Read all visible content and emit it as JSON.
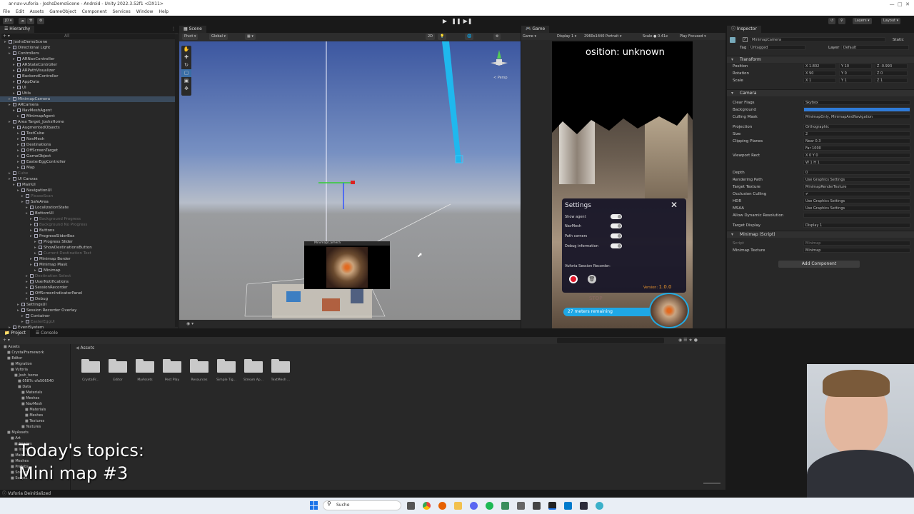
{
  "window": {
    "title": "ar-nav-vuforia - JoshsDemoScene - Android - Unity 2022.3.52f1 <DX11>"
  },
  "menu": [
    "File",
    "Edit",
    "Assets",
    "GameObject",
    "Component",
    "Services",
    "Window",
    "Help"
  ],
  "toolbar": {
    "account": "JD",
    "layers": "Layers",
    "layout": "Layout"
  },
  "hierarchy": {
    "tab": "Hierarchy",
    "search_placeholder": "All",
    "items": [
      {
        "label": "JoshsDemoScene",
        "depth": 1,
        "state": "normal"
      },
      {
        "label": "Directional Light",
        "depth": 2,
        "state": "normal"
      },
      {
        "label": "Controllers",
        "depth": 2,
        "state": "normal"
      },
      {
        "label": "ARNavController",
        "depth": 3,
        "state": "normal"
      },
      {
        "label": "ARStateController",
        "depth": 3,
        "state": "normal"
      },
      {
        "label": "ARPathVisualizer",
        "depth": 3,
        "state": "normal"
      },
      {
        "label": "BackendController",
        "depth": 3,
        "state": "normal"
      },
      {
        "label": "AppData",
        "depth": 3,
        "state": "normal"
      },
      {
        "label": "UI",
        "depth": 3,
        "state": "normal"
      },
      {
        "label": "Utils",
        "depth": 3,
        "state": "normal"
      },
      {
        "label": "MinimapCamera",
        "depth": 2,
        "state": "selected"
      },
      {
        "label": "ARCamera",
        "depth": 2,
        "state": "normal"
      },
      {
        "label": "NavMeshAgent",
        "depth": 3,
        "state": "normal"
      },
      {
        "label": "MinimapAgent",
        "depth": 4,
        "state": "normal"
      },
      {
        "label": "Area Target_JoshsHome",
        "depth": 2,
        "state": "normal"
      },
      {
        "label": "AugmentedObjects",
        "depth": 3,
        "state": "normal"
      },
      {
        "label": "TestCube",
        "depth": 4,
        "state": "normal"
      },
      {
        "label": "NavMesh",
        "depth": 4,
        "state": "normal"
      },
      {
        "label": "Destinations",
        "depth": 4,
        "state": "normal"
      },
      {
        "label": "OffScreenTarget",
        "depth": 4,
        "state": "normal"
      },
      {
        "label": "GameObject",
        "depth": 4,
        "state": "normal"
      },
      {
        "label": "EasterEggController",
        "depth": 4,
        "state": "normal"
      },
      {
        "label": "Map",
        "depth": 4,
        "state": "normal"
      },
      {
        "label": "Cube",
        "depth": 2,
        "state": "dim"
      },
      {
        "label": "UI Canvas",
        "depth": 2,
        "state": "normal"
      },
      {
        "label": "MainUI",
        "depth": 3,
        "state": "normal"
      },
      {
        "label": "NavigationUI",
        "depth": 4,
        "state": "normal"
      },
      {
        "label": "PleaseScan",
        "depth": 5,
        "state": "dim"
      },
      {
        "label": "SafeArea",
        "depth": 5,
        "state": "normal"
      },
      {
        "label": "LocalizationState",
        "depth": 6,
        "state": "normal"
      },
      {
        "label": "BottomUI",
        "depth": 6,
        "state": "normal"
      },
      {
        "label": "Background Progress",
        "depth": 7,
        "state": "dim"
      },
      {
        "label": "Background No Progress",
        "depth": 7,
        "state": "dim"
      },
      {
        "label": "Buttons",
        "depth": 7,
        "state": "normal"
      },
      {
        "label": "ProgressSliderBox",
        "depth": 7,
        "state": "normal"
      },
      {
        "label": "Progress Slider",
        "depth": 8,
        "state": "normal"
      },
      {
        "label": "ShowDestinationsButton",
        "depth": 8,
        "state": "normal"
      },
      {
        "label": "Current Destination Text",
        "depth": 8,
        "state": "dim"
      },
      {
        "label": "Minimap Border",
        "depth": 7,
        "state": "normal"
      },
      {
        "label": "Minimap Mask",
        "depth": 7,
        "state": "normal"
      },
      {
        "label": "Minimap",
        "depth": 8,
        "state": "normal"
      },
      {
        "label": "Destination Select",
        "depth": 6,
        "state": "dim"
      },
      {
        "label": "UserNotifications",
        "depth": 6,
        "state": "normal"
      },
      {
        "label": "SessionRecorder",
        "depth": 6,
        "state": "normal"
      },
      {
        "label": "OffScreenIndicatorPanel",
        "depth": 6,
        "state": "normal"
      },
      {
        "label": "Debug",
        "depth": 6,
        "state": "normal"
      },
      {
        "label": "SettingsUI",
        "depth": 4,
        "state": "normal"
      },
      {
        "label": "Session Recorder Overlay",
        "depth": 4,
        "state": "normal"
      },
      {
        "label": "Container",
        "depth": 5,
        "state": "normal"
      },
      {
        "label": "EasterEggUI",
        "depth": 5,
        "state": "dim"
      },
      {
        "label": "EventSystem",
        "depth": 2,
        "state": "normal"
      }
    ]
  },
  "scene": {
    "tab": "Scene",
    "pivot": "Pivot",
    "global": "Global",
    "mode_2d": "2D",
    "persp": "< Persp",
    "minimap_camera_label": "MinimapCamera"
  },
  "game": {
    "tab": "Game",
    "mode": "Game",
    "display": "Display 1",
    "resolution": "2960x1440 Portrait",
    "scale_label": "Scale",
    "scale_value": "0.41x",
    "play_focused": "Play Focused",
    "position_text": "osition: unknown",
    "settings": {
      "title": "Settings",
      "options": [
        "Show agent",
        "NavMesh",
        "Path corners",
        "Debug information"
      ],
      "recorder_label": "Vuforia Session Recorder:",
      "version_label": "Version:",
      "version_value": "1.0.0",
      "stop_label": "STOP"
    },
    "remaining": "27 meters remaining"
  },
  "inspector": {
    "tab": "Inspector",
    "object_name": "MinimapCamera",
    "static_label": "Static",
    "tag_label": "Tag",
    "tag_value": "Untagged",
    "layer_label": "Layer",
    "layer_value": "Default",
    "transform": {
      "title": "Transform",
      "position": {
        "label": "Position",
        "x": "1.802",
        "y": "10",
        "z": "-0.993"
      },
      "rotation": {
        "label": "Rotation",
        "x": "90",
        "y": "0",
        "z": "0"
      },
      "scale": {
        "label": "Scale",
        "x": "1",
        "y": "1",
        "z": "1"
      }
    },
    "camera": {
      "title": "Camera",
      "rows": [
        {
          "label": "Clear Flags",
          "value": "Skybox"
        },
        {
          "label": "Background",
          "value": ""
        },
        {
          "label": "Culling Mask",
          "value": "MinimapOnly, MinimapAndNavigation"
        },
        {
          "label": "Projection",
          "value": "Orthographic"
        },
        {
          "label": "Size",
          "value": "2"
        },
        {
          "label": "Clipping Planes",
          "value": "Near  0.3"
        },
        {
          "label": "",
          "value": "Far   1000"
        },
        {
          "label": "Viewport Rect",
          "value": "X 0          Y 0"
        },
        {
          "label": "",
          "value": "W 1          H 1"
        },
        {
          "label": "Depth",
          "value": "0"
        },
        {
          "label": "Rendering Path",
          "value": "Use Graphics Settings"
        },
        {
          "label": "Target Texture",
          "value": "MinimapRenderTexture"
        },
        {
          "label": "Occlusion Culling",
          "value": "✔"
        },
        {
          "label": "HDR",
          "value": "Use Graphics Settings"
        },
        {
          "label": "MSAA",
          "value": "Use Graphics Settings"
        },
        {
          "label": "Allow Dynamic Resolution",
          "value": ""
        },
        {
          "label": "Target Display",
          "value": "Display 1"
        }
      ]
    },
    "script": {
      "title": "Minimap (Script)",
      "script_label": "Script",
      "script_value": "Minimap",
      "texture_label": "Minimap Texture",
      "texture_value": "Minimap"
    },
    "add_component": "Add Component"
  },
  "project": {
    "tabs": [
      "Project",
      "Console"
    ],
    "tree": [
      {
        "label": "Assets",
        "depth": 1
      },
      {
        "label": "CrystalFramework",
        "depth": 2
      },
      {
        "label": "Editor",
        "depth": 2
      },
      {
        "label": "Migration",
        "depth": 3
      },
      {
        "label": "Vuforia",
        "depth": 3
      },
      {
        "label": "Josh_home",
        "depth": 4
      },
      {
        "label": "0587c cfa506540",
        "depth": 5
      },
      {
        "label": "Data",
        "depth": 5
      },
      {
        "label": "Materials",
        "depth": 6
      },
      {
        "label": "Meshes",
        "depth": 6
      },
      {
        "label": "NavMesh",
        "depth": 6
      },
      {
        "label": "Materials",
        "depth": 7
      },
      {
        "label": "Meshes",
        "depth": 7
      },
      {
        "label": "Textures",
        "depth": 7
      },
      {
        "label": "Textures",
        "depth": 6
      },
      {
        "label": "MyAssets",
        "depth": 2
      },
      {
        "label": "Art",
        "depth": 3
      },
      {
        "label": "Images",
        "depth": 4
      },
      {
        "label": "Icons",
        "depth": 4
      },
      {
        "label": "Materials",
        "depth": 3
      },
      {
        "label": "Meshes",
        "depth": 3
      },
      {
        "label": "Prefabs",
        "depth": 3
      },
      {
        "label": "Scenes",
        "depth": 3
      },
      {
        "label": "Scripts",
        "depth": 3
      }
    ],
    "breadcrumb": "Assets",
    "folders": [
      "CrystalFr...",
      "Editor",
      "MyAssets",
      "Pest Play",
      "Resources",
      "Simple Tig...",
      "Stream Ap...",
      "TextMesh ..."
    ]
  },
  "status": {
    "text": "Vuforia Deinitialized"
  },
  "overlay": {
    "line1": "Today's topics:",
    "line2": "Mini map #3"
  },
  "taskbar": {
    "search_placeholder": "Suche"
  },
  "colors": {
    "accent": "#2f7bd8",
    "selection": "#3a4a5c",
    "record": "#e0182b",
    "version": "#e7932e"
  }
}
